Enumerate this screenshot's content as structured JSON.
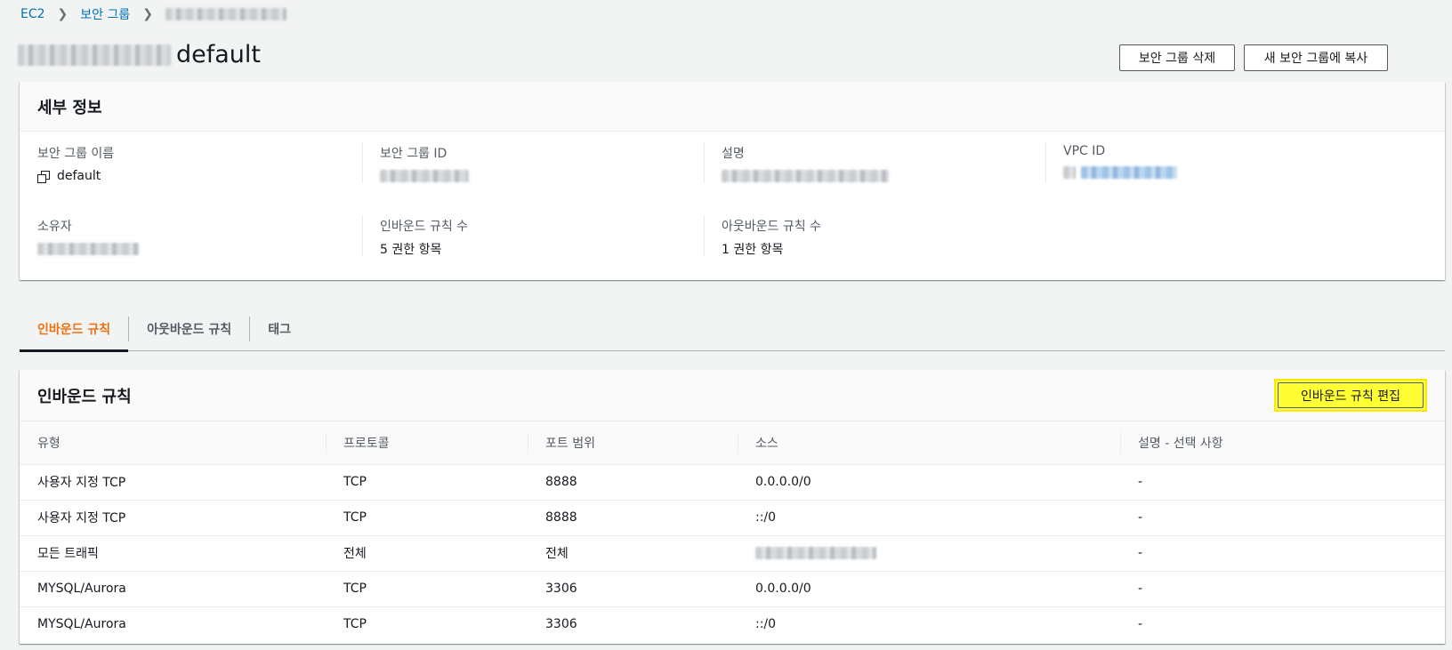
{
  "breadcrumb": {
    "root": "EC2",
    "parent": "보안 그룹"
  },
  "header": {
    "title_suffix": "default",
    "delete_button": "보안 그룹 삭제",
    "copy_button": "새 보안 그룹에 복사"
  },
  "details": {
    "heading": "세부 정보",
    "sg_name_label": "보안 그룹 이름",
    "sg_name_value": "default",
    "sg_id_label": "보안 그룹 ID",
    "description_label": "설명",
    "vpc_id_label": "VPC ID",
    "owner_label": "소유자",
    "inbound_count_label": "인바운드 규칙 수",
    "inbound_count_value": "5 권한 항목",
    "outbound_count_label": "아웃바운드 규칙 수",
    "outbound_count_value": "1 권한 항목"
  },
  "tabs": [
    {
      "label": "인바운드 규칙",
      "active": true
    },
    {
      "label": "아웃바운드 규칙",
      "active": false
    },
    {
      "label": "태그",
      "active": false
    }
  ],
  "inbound": {
    "heading": "인바운드 규칙",
    "edit_button": "인바운드 규칙 편집",
    "columns": [
      "유형",
      "프로토콜",
      "포트 범위",
      "소스",
      "설명 - 선택 사항"
    ],
    "rows": [
      {
        "type": "사용자 지정 TCP",
        "protocol": "TCP",
        "port": "8888",
        "source": "0.0.0.0/0",
        "description": "-"
      },
      {
        "type": "사용자 지정 TCP",
        "protocol": "TCP",
        "port": "8888",
        "source": "::/0",
        "description": "-"
      },
      {
        "type": "모든 트래픽",
        "protocol": "전체",
        "port": "전체",
        "source": "",
        "description": "-"
      },
      {
        "type": "MYSQL/Aurora",
        "protocol": "TCP",
        "port": "3306",
        "source": "0.0.0.0/0",
        "description": "-"
      },
      {
        "type": "MYSQL/Aurora",
        "protocol": "TCP",
        "port": "3306",
        "source": "::/0",
        "description": "-"
      }
    ]
  }
}
